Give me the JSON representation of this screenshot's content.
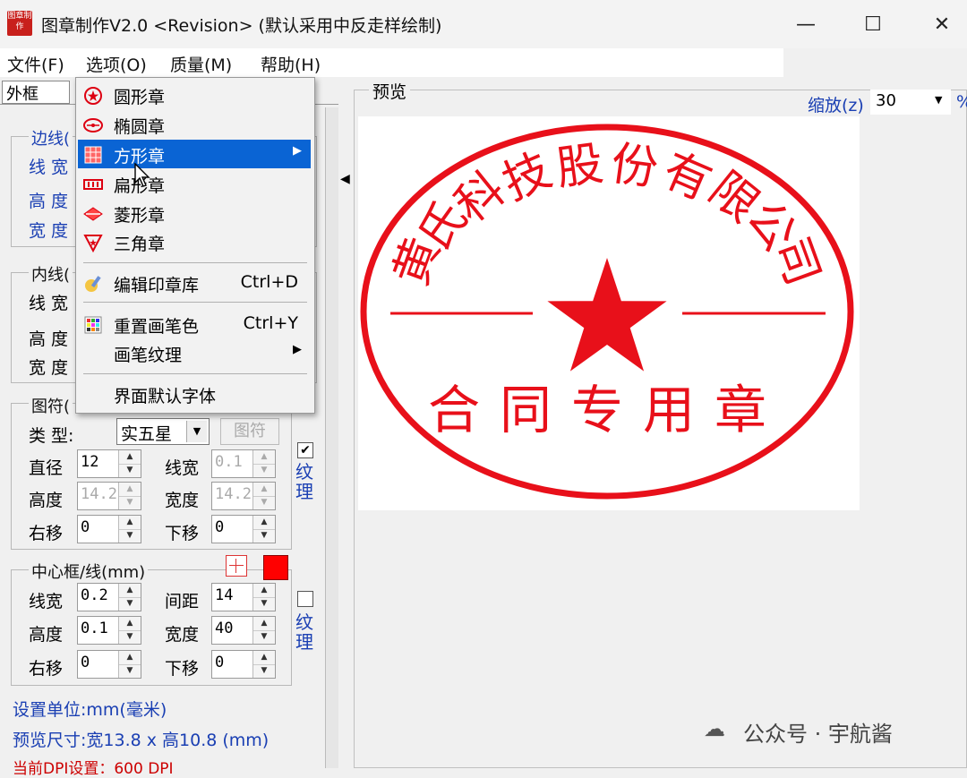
{
  "window": {
    "title": "图章制作V2.0 <Revision> (默认采用中反走样绘制)",
    "app_icon_text": "图章制作",
    "controls": {
      "minimize": "—",
      "maximize": "☐",
      "close": "✕"
    }
  },
  "menubar": {
    "items": [
      "文件(F)",
      "选项(O)",
      "质量(M)",
      "帮助(H)"
    ]
  },
  "left_panel": {
    "tab": "外框",
    "border_group": {
      "title": "边线(",
      "line_label": "线 宽",
      "height_label": "高 度",
      "width_label": "宽 度"
    },
    "inner_group": {
      "title": "内线(",
      "line_label": "线 宽",
      "height_label": "高 度",
      "width_label": "宽 度"
    },
    "symbol_group": {
      "title": "图符(",
      "type_label": "类  型:",
      "type_value": "实五星",
      "symbol_button": "图符",
      "diameter_label": "直径",
      "diameter_value": "12",
      "linewidth_label": "线宽",
      "linewidth_value": "0.1",
      "height_label": "高度",
      "height_value": "14.2",
      "width_label": "宽度",
      "width_value": "14.2",
      "right_label": "右移",
      "right_value": "0",
      "down_label": "下移",
      "down_value": "0",
      "texture_checked": "✔",
      "texture_label": "纹理"
    },
    "center_group": {
      "title": "中心框/线(mm)",
      "linewidth_label": "线宽",
      "linewidth_value": "0.2",
      "spacing_label": "间距",
      "spacing_value": "14",
      "height_label": "高度",
      "height_value": "0.1",
      "width_label": "宽度",
      "width_value": "40",
      "right_label": "右移",
      "right_value": "0",
      "down_label": "下移",
      "down_value": "0",
      "texture_label": "纹理"
    },
    "unit_text": "设置单位:mm(毫米)",
    "preview_size": "预览尺寸:宽13.8 x 高10.8 (mm)",
    "dpi_text": "当前DPI设置：600 DPI"
  },
  "dropdown": {
    "items": [
      {
        "label": "圆形章",
        "icon": "circle-stamp-icon"
      },
      {
        "label": "椭圆章",
        "icon": "ellipse-stamp-icon"
      },
      {
        "label": "方形章",
        "icon": "square-stamp-icon",
        "submenu": "▶"
      },
      {
        "label": "扁形章",
        "icon": "flat-stamp-icon"
      },
      {
        "label": "菱形章",
        "icon": "diamond-stamp-icon"
      },
      {
        "label": "三角章",
        "icon": "triangle-stamp-icon"
      },
      {
        "label": "编辑印章库",
        "icon": "edit-library-icon",
        "shortcut": "Ctrl+D"
      },
      {
        "label": "重置画笔色",
        "icon": "palette-icon",
        "shortcut": "Ctrl+Y"
      },
      {
        "label": "画笔纹理",
        "submenu": "▶"
      },
      {
        "label": "界面默认字体"
      }
    ]
  },
  "preview": {
    "label": "预览",
    "zoom_label": "缩放(z)",
    "zoom_value": "30",
    "zoom_suffix": "%"
  },
  "stamp": {
    "company": "黄氏科技股份有限公司",
    "purpose": "合同专用章",
    "color": "#e8101a"
  },
  "watermark": "公众号 · 宇航酱"
}
